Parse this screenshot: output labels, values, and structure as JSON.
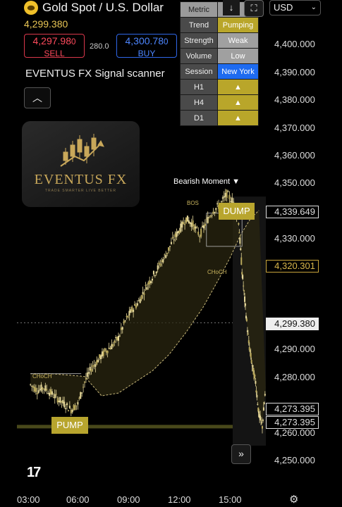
{
  "header": {
    "title": "Gold Spot / U.S. Dollar",
    "last_price": "4,299.380",
    "sell": {
      "price": "4,297.98",
      "sup": "0",
      "label": "SELL"
    },
    "spread": "280.0",
    "buy": {
      "price": "4,300.78",
      "sup": "0",
      "label": "BUY"
    },
    "symbol_select": "USD",
    "scanner_title": "EVENTUS FX Signal scanner"
  },
  "toolbar": {
    "down_arrow": "↓",
    "fullscreen": "⛶"
  },
  "logo": {
    "brand": "EVENTUS FX",
    "tagline": "TRADE SMARTER LIVE BETTER"
  },
  "metric_table": {
    "header": [
      "Metric",
      ""
    ],
    "rows": [
      {
        "label": "Trend",
        "value": "Pumping"
      },
      {
        "label": "Strength",
        "value": "Weak"
      },
      {
        "label": "Volume",
        "value": "Low"
      },
      {
        "label": "Session",
        "value": "New York"
      },
      {
        "label": "H1",
        "value": "▲"
      },
      {
        "label": "H4",
        "value": "▲"
      },
      {
        "label": "D1",
        "value": "▲"
      }
    ]
  },
  "annotations": {
    "bearish": "Bearish Moment ▼",
    "bos": "BOS",
    "choch_right": "CHoCH",
    "choch_left": "CHoCH",
    "pump_top": "DUMP",
    "pump_bottom": "PUMP"
  },
  "price_labels": {
    "p1": "4,339.649",
    "p2": "4,320.301",
    "p3": "4,299.380",
    "p4": "4,273.395",
    "p5": "4,273.395"
  },
  "colors": {
    "background": "#000000",
    "candle": "#e6d89a",
    "signal_gold": "#b8a52e",
    "sell": "#ff4a5c",
    "buy": "#4d86ff",
    "session_blue": "#1e6bf0"
  },
  "chart_data": {
    "type": "candlestick",
    "y_ticks": [
      "4,400.000",
      "4,390.000",
      "4,380.000",
      "4,370.000",
      "4,360.000",
      "4,350.000",
      "4,330.000",
      "4,290.000",
      "4,280.000",
      "4,260.000",
      "4,250.000"
    ],
    "x_ticks": [
      "03:00",
      "06:00",
      "09:00",
      "12:00",
      "15:00"
    ],
    "ylim": [
      4245,
      4405
    ],
    "close_path": [
      [
        2.8,
        4277
      ],
      [
        3.2,
        4275
      ],
      [
        3.6,
        4276
      ],
      [
        4.0,
        4274
      ],
      [
        4.4,
        4272
      ],
      [
        4.8,
        4270
      ],
      [
        5.2,
        4268
      ],
      [
        5.6,
        4270
      ],
      [
        6.0,
        4278
      ],
      [
        6.4,
        4283
      ],
      [
        6.8,
        4286
      ],
      [
        7.2,
        4289
      ],
      [
        7.6,
        4291
      ],
      [
        8.0,
        4294
      ],
      [
        8.4,
        4300
      ],
      [
        8.8,
        4304
      ],
      [
        9.2,
        4307
      ],
      [
        9.6,
        4312
      ],
      [
        10.0,
        4316
      ],
      [
        10.4,
        4320
      ],
      [
        10.8,
        4324
      ],
      [
        11.2,
        4329
      ],
      [
        11.6,
        4333
      ],
      [
        12.0,
        4337
      ],
      [
        12.4,
        4335
      ],
      [
        12.8,
        4331
      ],
      [
        13.2,
        4336
      ],
      [
        13.6,
        4340
      ],
      [
        14.0,
        4342
      ],
      [
        14.4,
        4346
      ],
      [
        14.8,
        4343
      ],
      [
        15.1,
        4336
      ],
      [
        15.3,
        4318
      ],
      [
        15.5,
        4305
      ],
      [
        15.7,
        4292
      ],
      [
        15.9,
        4284
      ],
      [
        16.1,
        4278
      ],
      [
        16.3,
        4266
      ],
      [
        16.5,
        4262
      ],
      [
        16.7,
        4276
      ]
    ],
    "ma_path": [
      [
        2.8,
        4281
      ],
      [
        4.0,
        4281
      ],
      [
        6.0,
        4280
      ],
      [
        7.0,
        4273
      ],
      [
        8.0,
        4274
      ],
      [
        9.0,
        4278
      ],
      [
        10.0,
        4282
      ],
      [
        11.0,
        4288
      ],
      [
        12.0,
        4296
      ],
      [
        13.0,
        4305
      ],
      [
        14.0,
        4316
      ],
      [
        14.6,
        4323
      ],
      [
        15.2,
        4331
      ],
      [
        15.8,
        4337
      ],
      [
        16.3,
        4340
      ]
    ]
  }
}
